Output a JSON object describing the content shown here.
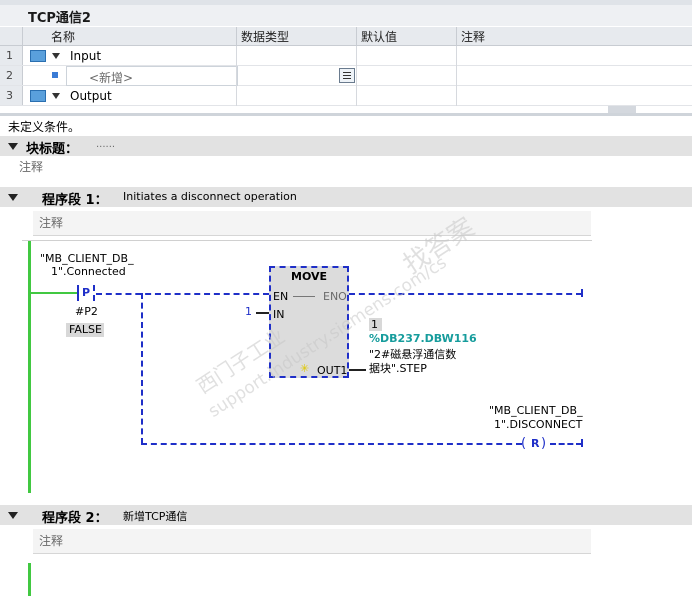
{
  "interface": {
    "title": "TCP通信2",
    "columns": [
      "名称",
      "数据类型",
      "默认值",
      "注释"
    ],
    "rows": [
      {
        "num": "1",
        "name": "Input"
      },
      {
        "num": "2",
        "name": "<新增>"
      },
      {
        "num": "3",
        "name": "Output"
      }
    ]
  },
  "undefined_condition": "未定义条件。",
  "block": {
    "title_label": "块标题：",
    "title_value": "......",
    "comment": "注释"
  },
  "networks": [
    {
      "label": "程序段 1：",
      "title": "Initiates a disconnect operation",
      "comment": "注释",
      "contact_operand_line1": "\"MB_CLIENT_DB_",
      "contact_operand_line2": "1\".Connected",
      "contact_type": "P",
      "edge_operand": "#P2",
      "status_value": "FALSE",
      "move_box": {
        "title": "MOVE",
        "en": "EN",
        "eno": "ENO",
        "in": "IN",
        "out": "OUT1",
        "in_value": "1",
        "out_value": "1",
        "out_address": "%DB237.DBW116",
        "out_tag_line1": "\"2#磁悬浮通信数",
        "out_tag_line2": "据块\".STEP"
      },
      "coil_operand_line1": "\"MB_CLIENT_DB_",
      "coil_operand_line2": "1\".DISCONNECT",
      "coil_type": "R"
    },
    {
      "label": "程序段 2：",
      "title": "新增TCP通信",
      "comment": "注释"
    }
  ],
  "watermark": {
    "brand": "西门子工业",
    "site": "support.industry.siemens.com/cs",
    "tag": "找答案"
  },
  "colors": {
    "ladder_blue": "#1f2fc8",
    "power_rail_green": "#41c841",
    "address_teal": "#169c9c"
  }
}
